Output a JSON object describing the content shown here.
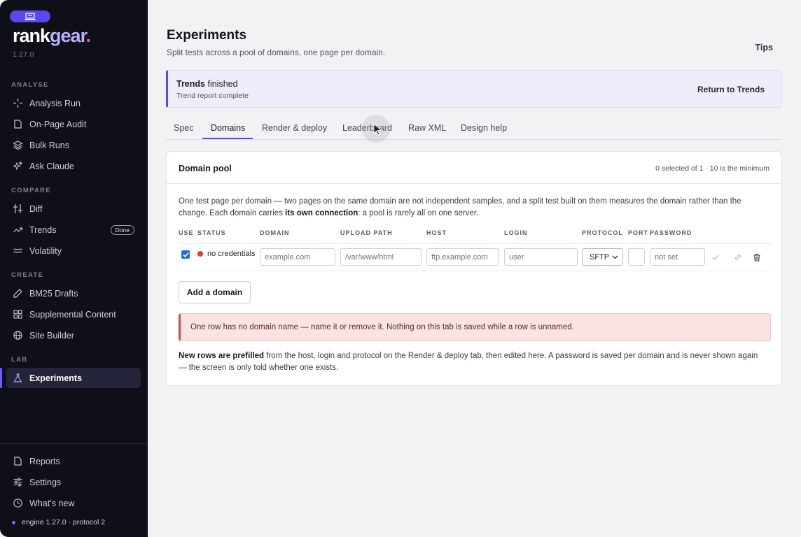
{
  "app": {
    "brand_main": "rank",
    "brand_accent": "gear",
    "brand_dot": ".",
    "version": "1.27.0"
  },
  "sidebar": {
    "sections": {
      "analyse": "ANALYSE",
      "compare": "COMPARE",
      "create": "CREATE",
      "lab": "LAB"
    },
    "items": [
      {
        "label": "Analysis Run"
      },
      {
        "label": "On-Page Audit"
      },
      {
        "label": "Bulk Runs"
      },
      {
        "label": "Ask Claude"
      },
      {
        "label": "Diff"
      },
      {
        "label": "Trends",
        "badge": "Done"
      },
      {
        "label": "Volatility"
      },
      {
        "label": "BM25 Drafts"
      },
      {
        "label": "Supplemental Content"
      },
      {
        "label": "Site Builder"
      },
      {
        "label": "Experiments"
      }
    ],
    "bottom": [
      {
        "label": "Reports"
      },
      {
        "label": "Settings"
      },
      {
        "label": "What’s new"
      }
    ],
    "engine": "engine 1.27.0 · protocol 2"
  },
  "page": {
    "title": "Experiments",
    "subtitle": "Split tests across a pool of domains, one page per domain.",
    "tips": "Tips"
  },
  "banner": {
    "title_bold": "Trends",
    "title_rest": " finished",
    "subtitle": "Trend report complete",
    "action": "Return to Trends"
  },
  "tabs": [
    "Spec",
    "Domains",
    "Render & deploy",
    "Leaderboard",
    "Raw XML",
    "Design help"
  ],
  "card": {
    "title": "Domain pool",
    "meta": "0 selected of 1 · 10 is the minimum",
    "desc_1": "One test page per domain — two pages on the same domain are not independent samples, and a split test built on them measures the domain rather than the change. Each domain carries ",
    "desc_bold": "its own connection",
    "desc_2": ": a pool is rarely all on one server.",
    "headers": {
      "use": "USE",
      "status": "STATUS",
      "domain": "DOMAIN",
      "path": "UPLOAD PATH",
      "host": "HOST",
      "login": "LOGIN",
      "protocol": "PROTOCOL",
      "port": "PORT",
      "password": "PASSWORD"
    },
    "row": {
      "status": "no credentials",
      "domain_ph": "example.com",
      "path_ph": "/var/www/html",
      "host_ph": "ftp.example.com",
      "login_ph": "user",
      "protocol": "SFTP",
      "port": "",
      "password": "not set"
    },
    "add_button": "Add a domain",
    "error": "One row has no domain name — name it or remove it. Nothing on this tab is saved while a row is unnamed.",
    "foot_bold": "New rows are prefilled",
    "foot_rest": " from the host, login and protocol on the Render & deploy tab, then edited here. A password is saved per domain and is never shown again — the screen is only told whether one exists."
  },
  "colors": {
    "accent": "#5a48ee",
    "sidebar_bg": "#0f0f17",
    "error": "#e04848",
    "status_dot": "#e03a3a"
  }
}
